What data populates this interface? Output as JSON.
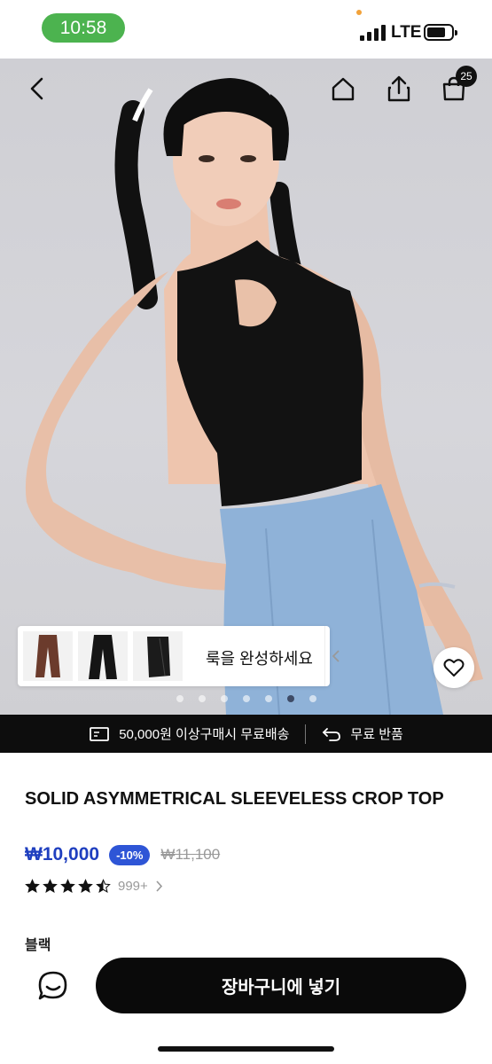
{
  "status_bar": {
    "time": "10:58",
    "network": "LTE"
  },
  "header": {
    "cart_count": "25",
    "icons": [
      "back-icon",
      "home-icon",
      "share-icon",
      "shopping-bag-icon"
    ]
  },
  "look": {
    "label": "룩을 완성하세요"
  },
  "carousel": {
    "slide_count": 7,
    "active_index": 5
  },
  "info_bar": {
    "shipping": "50,000원 이상구매시 무료배송",
    "returns": "무료 반품"
  },
  "product": {
    "title": "SOLID ASYMMETRICAL SLEEVELESS CROP TOP",
    "price": "₩10,000",
    "discount": "-10%",
    "original_price": "₩11,100",
    "rating": 4.5,
    "review_count": "999+",
    "brand": "블랙"
  },
  "actions": {
    "add_to_cart": "장바구니에 넣기"
  },
  "colors": {
    "price_blue": "#1f3fbf",
    "badge_blue": "#2e55d6",
    "time_green": "#4cb34f"
  }
}
